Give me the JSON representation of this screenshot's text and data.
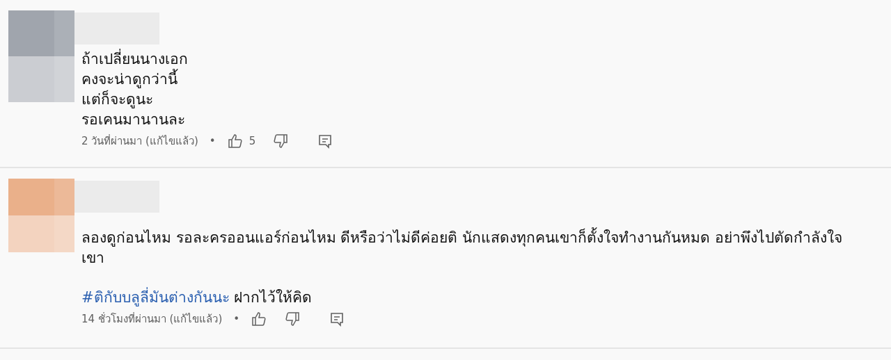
{
  "comments": [
    {
      "color": "#a0a5ad",
      "separator": "•",
      "lines": [
        "ถ้าเปลี่ยนนางเอก",
        "คงจะน่าดูกว่านี้",
        "แต่ก็จะดูนะ",
        "รอเคนมานานละ"
      ],
      "time": "2 วันที่ผ่านมา (แก้ไขแล้ว)",
      "likes": "5"
    },
    {
      "color": "#eab08a",
      "separator": "•",
      "paragraphs": [
        [
          {
            "kind": "text",
            "text": "ลองดูก่อนไหม รอละครออนแอร์ก่อนไหม ดีหรือว่าไม่ดีค่อยติ นักแสดงทุกคนเขาก็ตั้งใจทำงานกันหมด อย่าพึงไปตัดกำลังใจเขา"
          }
        ],
        [
          {
            "kind": "hashtag",
            "text": "#ติกับบลูลี่มันต่างกันนะ"
          },
          {
            "kind": "text",
            "text": " ฝากไว้ให้คิด"
          }
        ]
      ],
      "time": "14 ชั่วโมงที่ผ่านมา (แก้ไขแล้ว)"
    }
  ]
}
